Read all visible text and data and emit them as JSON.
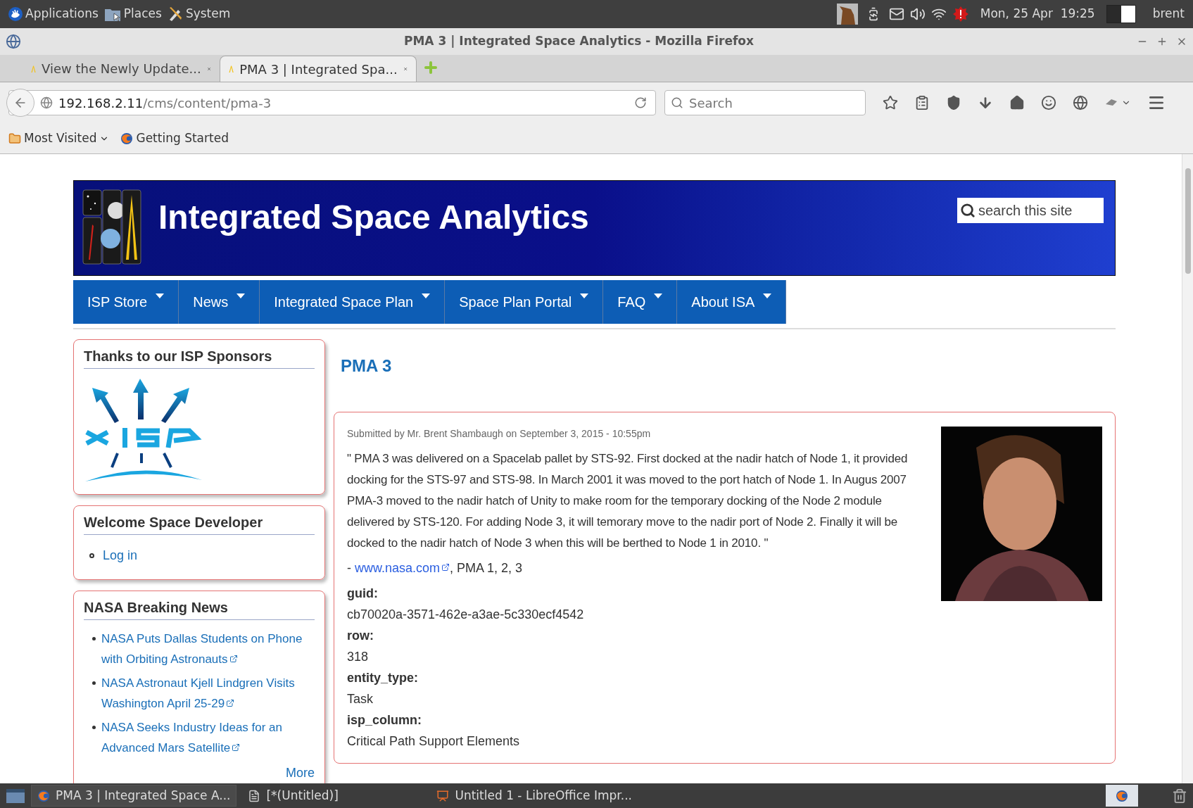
{
  "top_panel": {
    "menus": [
      {
        "label": "Applications",
        "kind": "apps"
      },
      {
        "label": "Places",
        "kind": "places"
      },
      {
        "label": "System",
        "kind": "system"
      }
    ],
    "clock": "Mon, 25 Apr  19:25",
    "user": "brent"
  },
  "window": {
    "title": "PMA 3 | Integrated Space Analytics - Mozilla Firefox"
  },
  "tabs": [
    {
      "label": "View the Newly Update...",
      "selected": false
    },
    {
      "label": "PMA 3 | Integrated Spa...",
      "selected": true
    }
  ],
  "address_bar": {
    "host": "192.168.2.11",
    "path": "/cms/content/pma-3"
  },
  "search": {
    "placeholder": "Search"
  },
  "bookmarks": [
    {
      "label": "Most Visited",
      "kind": "folder"
    },
    {
      "label": "Getting Started",
      "kind": "firefox"
    }
  ],
  "site": {
    "title": "Integrated Space Analytics",
    "search_placeholder": "search this site"
  },
  "menu": [
    "ISP Store",
    "News",
    "Integrated Space Plan",
    "Space Plan Portal",
    "FAQ",
    "About ISA"
  ],
  "sidebar": {
    "sponsors": {
      "title": "Thanks to our ISP Sponsors"
    },
    "welcome": {
      "title": "Welcome Space Developer",
      "links": [
        "Log in"
      ]
    },
    "news": {
      "title": "NASA Breaking News",
      "items": [
        "NASA Puts Dallas Students on Phone with Orbiting Astronauts",
        "NASA Astronaut Kjell Lindgren Visits Washington April 25-29",
        "NASA Seeks Industry Ideas for an Advanced Mars Satellite"
      ],
      "more": "More"
    }
  },
  "article": {
    "heading": "PMA 3",
    "submitted": "Submitted by Mr. Brent Shambaugh on September 3, 2015 - 10:55pm",
    "body": "\" PMA 3 was delivered on a Spacelab pallet by STS-92. First docked at the nadir hatch of Node 1, it provided docking for the STS-97 and STS-98. In March 2001 it was moved to the port hatch of Node 1. In Augus 2007 PMA-3 moved to the nadir hatch of Unity to make room for the temporary docking of the Node 2 module delivered by STS-120. For adding Node 3, it will temorary move to the nadir port of Node 2. Finally it will be docked to the nadir hatch of Node 3 when this will be berthed to Node 1 in 2010. \"",
    "source": {
      "prefix": "- ",
      "link": "www.nasa.com",
      "suffix": ", PMA 1, 2, 3"
    },
    "fields": [
      {
        "label": "guid:",
        "value": "cb70020a-3571-462e-a3ae-5c330ecf4542"
      },
      {
        "label": "row:",
        "value": "318"
      },
      {
        "label": "entity_type:",
        "value": "Task"
      },
      {
        "label": "isp_column:",
        "value": "Critical Path Support Elements"
      }
    ]
  },
  "taskbar": [
    {
      "label": "PMA 3 | Integrated Space A...",
      "kind": "firefox",
      "selected": true
    },
    {
      "label": "[*(Untitled)]",
      "kind": "editor",
      "selected": false
    },
    {
      "label": "Untitled 1 - LibreOffice Impr...",
      "kind": "impress",
      "selected": false
    }
  ]
}
